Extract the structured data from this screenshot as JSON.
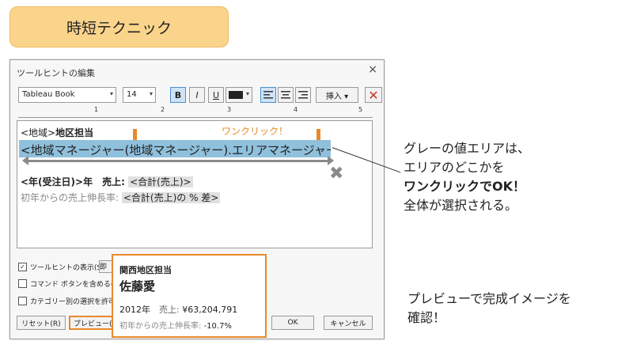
{
  "badge": {
    "title": "時短テクニック",
    "color": "#fbd48c"
  },
  "dialog": {
    "title": "ツールヒントの編集",
    "close_icon": "×",
    "toolbar": {
      "font": "Tableau Book",
      "size": "14",
      "bold": "B",
      "italic": "I",
      "underline": "U",
      "insert": "挿入 ▾",
      "clear": "✕"
    },
    "ruler": [
      "1",
      "2",
      "3",
      "4",
      "5"
    ],
    "editor": {
      "line1_a": "<地域>",
      "line1_b": "地区担当",
      "line2": "<地域マネージャー(地域マネージャー).エリアマネージャー>",
      "line3_a": "<年(受注日)>",
      "line3_b": "年　売上: ",
      "line3_c": "<合計(売上)>",
      "line4_a": "初年からの売上伸長率: ",
      "line4_b": "<合計(売上)の % 差>",
      "highlight_color": "#8fc0dc"
    },
    "annotation_oneclick": "ワンクリック！",
    "checkboxes": [
      {
        "label": "ツールヒントの表示(S)",
        "checked": true
      },
      {
        "label": "コマンド ボタンを含める(I)",
        "checked": false
      },
      {
        "label": "カテゴリー別の選択を許可(A",
        "checked": false
      }
    ],
    "hidden_btn": "即",
    "buttons": {
      "reset": "リセット(R)",
      "preview": "プレビュー(P",
      "ok": "OK",
      "cancel": "キャンセル"
    }
  },
  "preview": {
    "region": "関西地区担当",
    "name": "佐藤愛",
    "year": "2012年",
    "sales_label": "売上:",
    "sales_value": "¥63,204,791",
    "growth_label": "初年からの売上伸長率:",
    "growth_value": "-10.7%"
  },
  "notes": {
    "n1_l1": "グレーの値エリアは、",
    "n1_l2": "エリアのどこかを",
    "n1_l3": "ワンクリックでOK！",
    "n1_l4": "全体が選択される。",
    "n2_l1": "プレビューで完成イメージを",
    "n2_l2": "確認！"
  },
  "accent_color": "#e8892a"
}
